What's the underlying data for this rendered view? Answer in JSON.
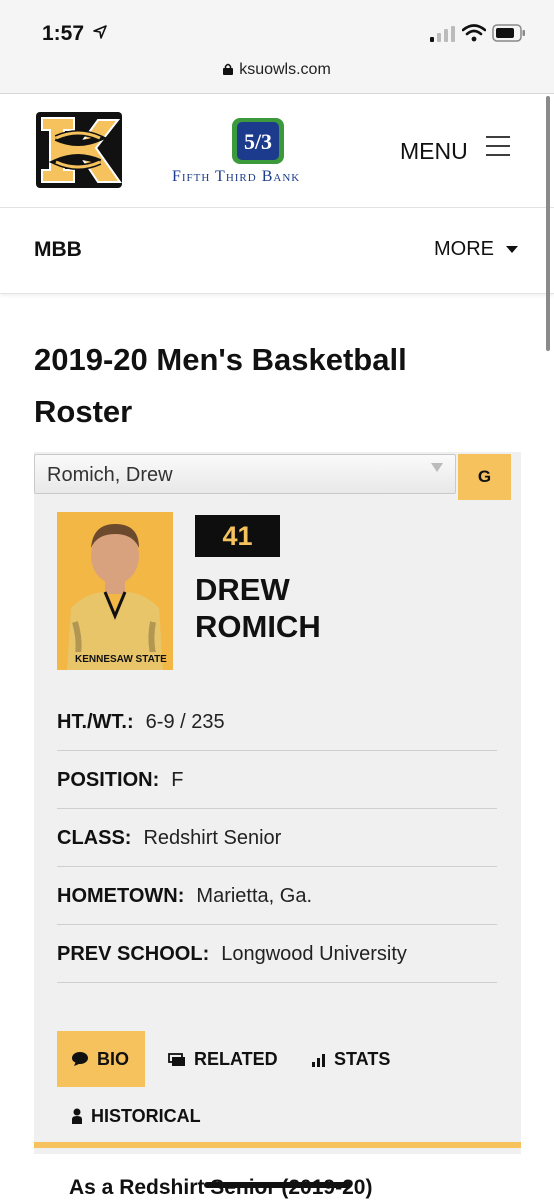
{
  "status_bar": {
    "time": "1:57"
  },
  "browser": {
    "url": "ksuowls.com"
  },
  "header": {
    "bank_name": "Fifth Third Bank",
    "menu_label": "MENU"
  },
  "subnav": {
    "section": "MBB",
    "more_label": "MORE"
  },
  "page": {
    "title": "2019-20 Men's Basketball Roster"
  },
  "roster": {
    "selected_player": "Romich, Drew",
    "position_badge": "G",
    "player": {
      "number": "41",
      "first_name": "DREW",
      "last_name": "ROMICH",
      "photo_caption": "KENNESAW STATE",
      "details": [
        {
          "label": "HT./WT.:",
          "value": "6-9 / 235"
        },
        {
          "label": "POSITION:",
          "value": "F"
        },
        {
          "label": "CLASS:",
          "value": "Redshirt Senior"
        },
        {
          "label": "HOMETOWN:",
          "value": "Marietta, Ga."
        },
        {
          "label": "PREV SCHOOL:",
          "value": "Longwood University"
        }
      ]
    },
    "tabs": [
      {
        "label": "BIO",
        "icon": "speech-bubble-icon",
        "active": true
      },
      {
        "label": "RELATED",
        "icon": "stacked-cards-icon",
        "active": false
      },
      {
        "label": "STATS",
        "icon": "bar-chart-icon",
        "active": false
      },
      {
        "label": "HISTORICAL",
        "icon": "person-icon",
        "active": false
      }
    ],
    "bio_heading": "As a Redshirt Senior (2019-20)"
  },
  "colors": {
    "accent": "#f5c25e",
    "dark": "#0e0e0e",
    "bank_blue": "#1d3b8c",
    "bank_green": "#3c9a3c"
  }
}
